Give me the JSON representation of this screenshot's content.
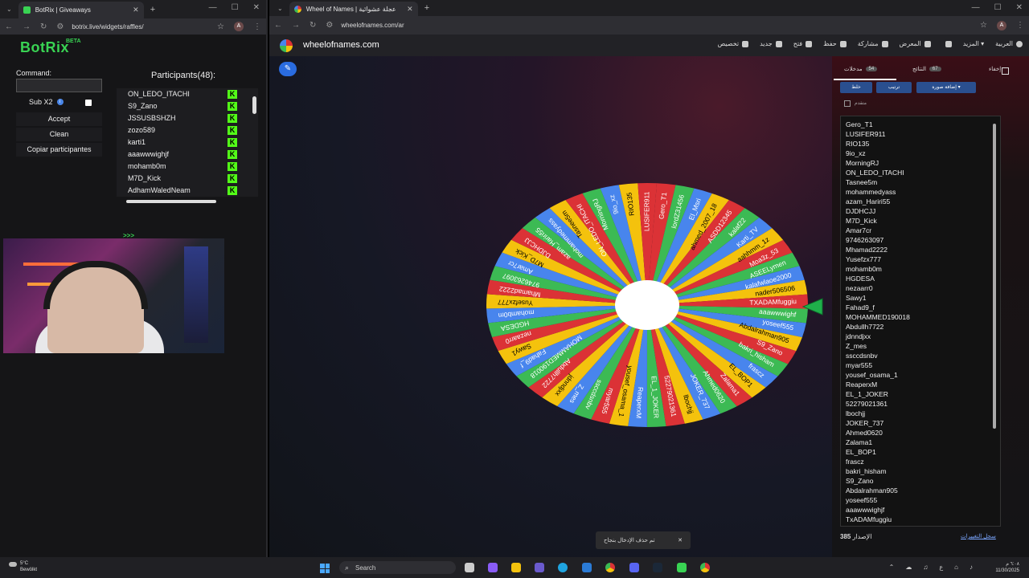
{
  "left_window": {
    "tab_title": "BotRix | Giveaways",
    "url": "botrix.live/widgets/raffles/",
    "profile_letter": "A"
  },
  "botrix": {
    "logo": "BotRix",
    "beta": "BETA",
    "command_label": "Command:",
    "sub_label": "Sub X2",
    "accept": "Accept",
    "clean": "Clean",
    "copy": "Copiar participantes",
    "participants_title": "Participants(48):",
    "participants": [
      "ON_LEDO_ITACHI",
      "S9_Zano",
      "JSSUSBSHZH",
      "zozo589",
      "karti1",
      "aaawwwighjf",
      "mohamb0m",
      "M7D_Kick",
      "AdhamWaledNeam"
    ]
  },
  "cam_overlay": ">>>",
  "right_window": {
    "tab_title": "Wheel of Names | عجلة عشوائية",
    "url": "wheelofnames.com/ar",
    "profile_letter": "A"
  },
  "site": {
    "name": "wheelofnames.com",
    "menu": [
      "تخصيص",
      "جديد",
      "فتح",
      "حفظ",
      "مشاركة",
      "المعرض",
      "المزيد",
      "العربية"
    ]
  },
  "wheel": {
    "pointer_color": "#1fb04a",
    "colors": [
      "#db3236",
      "#3cba54",
      "#4885ed",
      "#f4c20d"
    ],
    "labels": [
      "Gero_T1",
      "lordZ31456",
      "El_Msri",
      "ahmed_2007_18",
      "ASDD12345",
      "kalaf22",
      "Karti_TV",
      "aahhmm_1z",
      "Moa3z_53",
      "ASEELymen",
      "kalafwlaoe2000",
      "nader506506",
      "TXADAMfuggiu",
      "aaawwwighf",
      "yoseef555",
      "Abdalrahman905",
      "S9_Zano",
      "bakri_hisham",
      "frascz",
      "EL_BOP1",
      "Zalama1",
      "Ahmed0620",
      "JOKER_737",
      "lbochjj",
      "52279021361",
      "EL_1_JOKER",
      "ReaperxM",
      "yousef_osama_1",
      "myar555",
      "ssccdsnbv",
      "Z_mes",
      "jdnndjxx",
      "Abdullh7722",
      "MOHAMMED190018",
      "Fahad9_f",
      "Sawy1",
      "nezaarr0",
      "HGDESA",
      "mohamb0m",
      "Yusefzx777",
      "Mhamad2222",
      "9746263097",
      "Amar7cr",
      "M7D_Kick",
      "DJDHCJJ",
      "azam_Hariri55",
      "mohammedyass",
      "Tasnee5m",
      "ON_LEDO_ITACHI",
      "MorningRJ",
      "9io_xz",
      "RIO135",
      "LUSIFER911"
    ]
  },
  "toast": {
    "text": "تم حذف الإدخال بنجاح",
    "close": "✕"
  },
  "panel": {
    "tab_entries": "مدخلات",
    "entries_count": "54",
    "tab_results": "النتائج",
    "results_count": "67",
    "hide": "إخفاء",
    "btn_shuffle": "خلط",
    "btn_sort": "ترتيب",
    "btn_add_image": "إضافة صورة",
    "advanced": "متقدم",
    "entries": [
      "Gero_T1",
      "LUSIFER911",
      "RIO135",
      "9io_xz",
      "MorningRJ",
      "ON_LEDO_ITACHI",
      "Tasnee5m",
      "mohammedyass",
      "azam_Hariri55",
      "DJDHCJJ",
      "M7D_Kick",
      "Amar7cr",
      "9746263097",
      "Mhamad2222",
      "Yusefzx777",
      "mohamb0m",
      "HGDESA",
      "nezaarr0",
      "Sawy1",
      "Fahad9_f",
      "MOHAMMED190018",
      "Abdullh7722",
      "jdnndjxx",
      "Z_mes",
      "ssccdsnbv",
      "myar555",
      "yousef_osama_1",
      "ReaperxM",
      "EL_1_JOKER",
      "52279021361",
      "lbochjj",
      "JOKER_737",
      "Ahmed0620",
      "Zalama1",
      "EL_BOP1",
      "frascz",
      "bakri_hisham",
      "S9_Zano",
      "Abdalrahman905",
      "yoseef555",
      "aaawwwighjf",
      "TxADAMfuggiu"
    ],
    "version_label": "الإصدار",
    "version": "385",
    "changelog": "سجل التغييرات"
  },
  "taskbar": {
    "temp": "5°C",
    "weather": "Bewölkt",
    "search": "Search",
    "time": "٦:٠٨ م",
    "date": "11/30/2025"
  }
}
